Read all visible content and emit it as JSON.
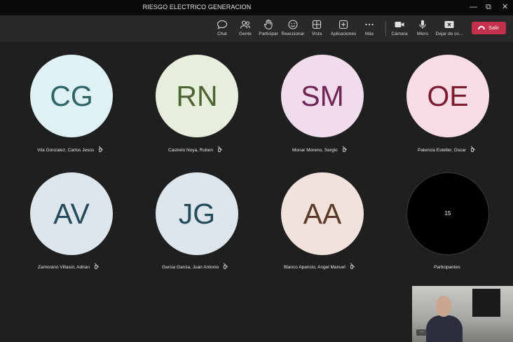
{
  "window": {
    "title": "RIESGO ELECTRICO GENERACION"
  },
  "toolbar": {
    "items": [
      {
        "label": "Chat"
      },
      {
        "label": "Gente"
      },
      {
        "label": "Participar"
      },
      {
        "label": "Reaccionar"
      },
      {
        "label": "Vista"
      },
      {
        "label": "Aplicaciones"
      },
      {
        "label": "Más"
      },
      {
        "label": "Cámara"
      },
      {
        "label": "Micro"
      },
      {
        "label": "Dejar de co..."
      }
    ],
    "leave_label": "Salir",
    "leave_color": "#c4314b"
  },
  "participants": [
    {
      "initials": "CG",
      "name": "Vila Gonzalez, Carlos Jesús",
      "bg": "#dff1f4",
      "fg": "#2e6468"
    },
    {
      "initials": "RN",
      "name": "Castrelo Noya, Ruben",
      "bg": "#e6efdc",
      "fg": "#4d6533"
    },
    {
      "initials": "SM",
      "name": "Monar Moreno, Sergio",
      "bg": "#f0dcec",
      "fg": "#6e2556"
    },
    {
      "initials": "OE",
      "name": "Palencia Esteller, Oscar",
      "bg": "#f7dde3",
      "fg": "#7b1c31"
    },
    {
      "initials": "AV",
      "name": "Zamorano Villasol, Adrian",
      "bg": "#dde6ed",
      "fg": "#254a5c"
    },
    {
      "initials": "JG",
      "name": "Garcia Garcia, Juan Antonio",
      "bg": "#dde6ed",
      "fg": "#254a5c"
    },
    {
      "initials": "AA",
      "name": "Blanco Aparicio, Angel Manuel",
      "bg": "#f1e3dc",
      "fg": "#5c3a2a"
    }
  ],
  "overflow": {
    "count": "15",
    "label": "Participantes"
  },
  "self_view": {
    "more_label": "..."
  }
}
